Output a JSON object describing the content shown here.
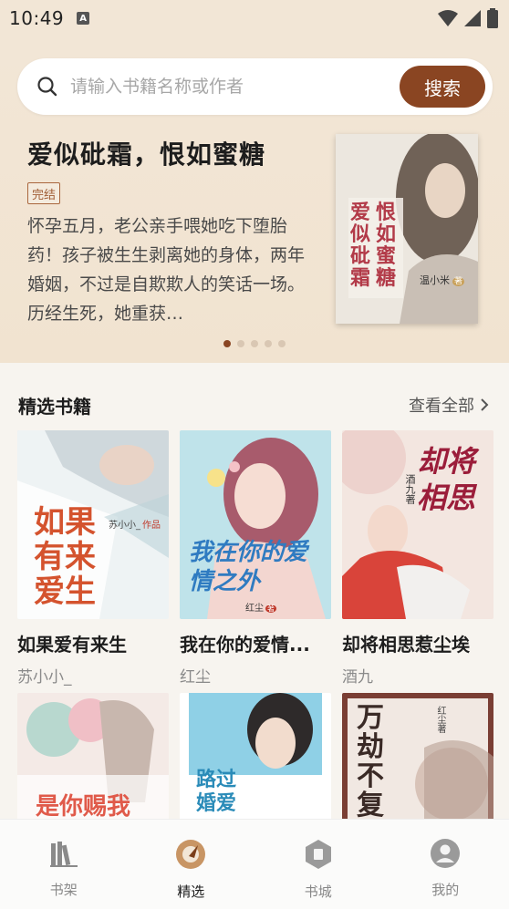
{
  "status_bar": {
    "time": "10:49",
    "notification_icon": "A"
  },
  "search": {
    "placeholder": "请输入书籍名称或作者",
    "button_label": "搜索"
  },
  "banner": {
    "title": "爱似砒霜，恨如蜜糖",
    "badge": "完结",
    "description": "怀孕五月，老公亲手喂她吃下堕胎药！孩子被生生剥离她的身体，两年婚姻，不过是自欺欺人的笑话一场。历经生死，她重获…",
    "cover_title": "爱似砒霜恨如蜜糖",
    "cover_author": "温小米",
    "cover_author_suffix": "著",
    "dots_total": 5,
    "dots_active": 1
  },
  "section": {
    "title": "精选书籍",
    "view_all": "查看全部"
  },
  "books": [
    {
      "title": "如果爱有来生",
      "author": "苏小小_",
      "cover_text": "如果有来爱生",
      "cover_author": "苏小小_",
      "cover_author_suffix": "作品"
    },
    {
      "title": "我在你的爱情...",
      "author": "红尘",
      "cover_text": "我在你的爱情之外",
      "cover_author": "红尘",
      "cover_author_suffix": "著"
    },
    {
      "title": "却将相思惹尘埃",
      "author": "酒九",
      "cover_text": "却将相思",
      "cover_author": "酒九",
      "cover_author_suffix": "著"
    },
    {
      "cover_text": "是你赐我"
    },
    {
      "cover_text": "路过婚爱"
    },
    {
      "cover_text": "万劫不复你给的",
      "cover_author": "红尘",
      "cover_author_suffix": "著"
    }
  ],
  "nav": [
    {
      "label": "书架",
      "icon": "bookshelf-icon"
    },
    {
      "label": "精选",
      "icon": "featured-icon",
      "active": true
    },
    {
      "label": "书城",
      "icon": "bookstore-icon"
    },
    {
      "label": "我的",
      "icon": "profile-icon"
    }
  ],
  "colors": {
    "accent": "#8a4522",
    "hero_bg": "#f2e6d6",
    "page_bg": "#f7f4ef"
  }
}
